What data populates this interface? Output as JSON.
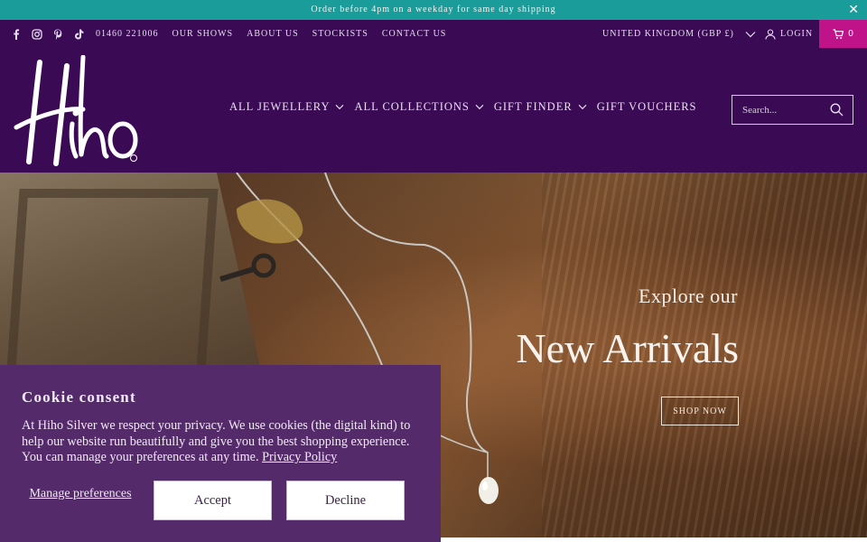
{
  "announcement": {
    "text": "Order before 4pm on a weekday for same day shipping",
    "close_icon": "close-icon"
  },
  "topbar": {
    "social": [
      "facebook-icon",
      "instagram-icon",
      "pinterest-icon",
      "tiktok-icon"
    ],
    "links": [
      "01460 221006",
      "OUR SHOWS",
      "ABOUT US",
      "STOCKISTS",
      "CONTACT US"
    ],
    "currency": "UNITED KINGDOM (GBP £)",
    "login": "LOGIN",
    "cart_count": "0"
  },
  "header": {
    "logo_text": "Hiho",
    "nav": [
      {
        "label": "ALL JEWELLERY",
        "has_dropdown": true
      },
      {
        "label": "ALL COLLECTIONS",
        "has_dropdown": true
      },
      {
        "label": "GIFT FINDER",
        "has_dropdown": true
      },
      {
        "label": "GIFT VOUCHERS",
        "has_dropdown": false
      }
    ],
    "search_placeholder": "Search..."
  },
  "hero": {
    "kicker": "Explore our",
    "headline": "New Arrivals",
    "button": "SHOP NOW"
  },
  "cookie": {
    "title": "Cookie consent",
    "body": "At Hiho Silver we respect your privacy. We use cookies (the digital kind) to help our website run beautifully and give you the best shopping experience. You can manage your preferences at any time.",
    "policy_link": "Privacy Policy",
    "manage": "Manage preferences",
    "accept": "Accept",
    "decline": "Decline"
  },
  "colors": {
    "announcement_bg": "#1a9d9a",
    "header_bg": "#3a0b54",
    "cart_bg": "#c0138a",
    "cookie_bg": "#552a6b"
  }
}
